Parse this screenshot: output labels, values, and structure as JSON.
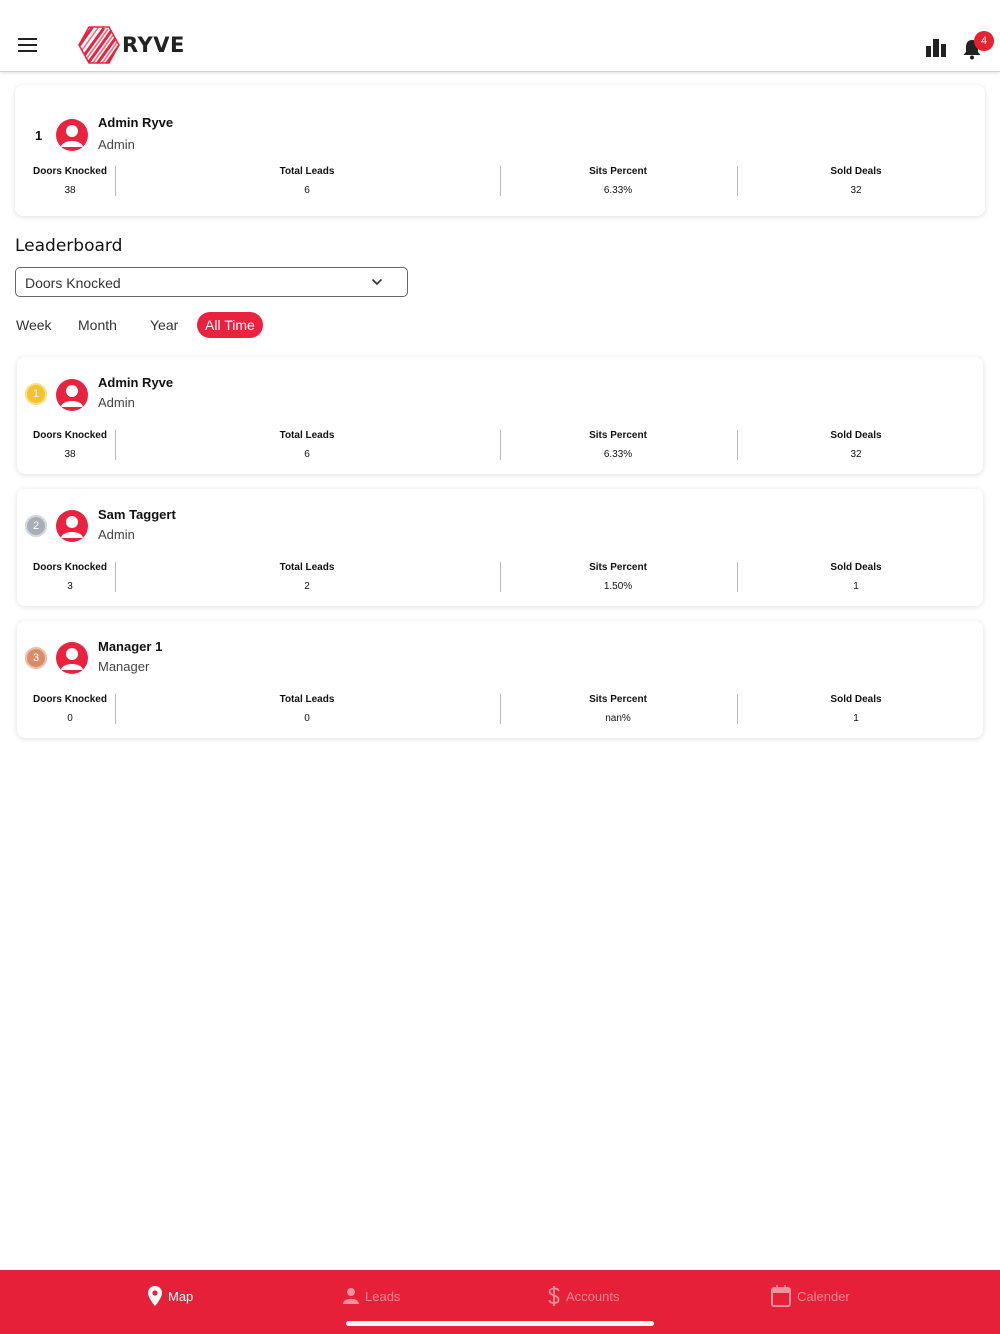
{
  "header": {
    "logo_text": "RYVE",
    "notification_count": "4",
    "accent_color": "#e8223f"
  },
  "my_stats": {
    "rank": "1",
    "name": "Admin Ryve",
    "role": "Admin",
    "doors_knocked_label": "Doors Knocked",
    "doors_knocked": "38",
    "total_leads_label": "Total Leads",
    "total_leads": "6",
    "sits_percent_label": "Sits Percent",
    "sits_percent": "6.33%",
    "sold_deals_label": "Sold Deals",
    "sold_deals": "32"
  },
  "leaderboard": {
    "title": "Leaderboard",
    "metric_selected": "Doors Knocked",
    "tabs": [
      "Week",
      "Month",
      "Year",
      "All Time"
    ],
    "active_tab": "All Time",
    "entries": [
      {
        "rank": "1",
        "medal_color": "#f2c230",
        "name": "Admin Ryve",
        "role": "Admin",
        "doors_knocked_label": "Doors Knocked",
        "doors_knocked": "38",
        "total_leads_label": "Total Leads",
        "total_leads": "6",
        "sits_percent_label": "Sits Percent",
        "sits_percent": "6.33%",
        "sold_deals_label": "Sold Deals",
        "sold_deals": "32"
      },
      {
        "rank": "2",
        "medal_color": "#a8aeb4",
        "name": "Sam Taggert",
        "role": "Admin",
        "doors_knocked_label": "Doors Knocked",
        "doors_knocked": "3",
        "total_leads_label": "Total Leads",
        "total_leads": "2",
        "sits_percent_label": "Sits Percent",
        "sits_percent": "1.50%",
        "sold_deals_label": "Sold Deals",
        "sold_deals": "1"
      },
      {
        "rank": "3",
        "medal_color": "#d98c6a",
        "name": "Manager 1",
        "role": "Manager",
        "doors_knocked_label": "Doors Knocked",
        "doors_knocked": "0",
        "total_leads_label": "Total Leads",
        "total_leads": "0",
        "sits_percent_label": "Sits Percent",
        "sits_percent": "nan%",
        "sold_deals_label": "Sold Deals",
        "sold_deals": "1"
      }
    ]
  },
  "bottom_nav": {
    "items": [
      {
        "label": "Map",
        "icon": "map-pin-icon",
        "active": true
      },
      {
        "label": "Leads",
        "icon": "person-icon",
        "active": false
      },
      {
        "label": "Accounts",
        "icon": "dollar-icon",
        "active": false
      },
      {
        "label": "Calender",
        "icon": "calendar-icon",
        "active": false
      }
    ]
  }
}
